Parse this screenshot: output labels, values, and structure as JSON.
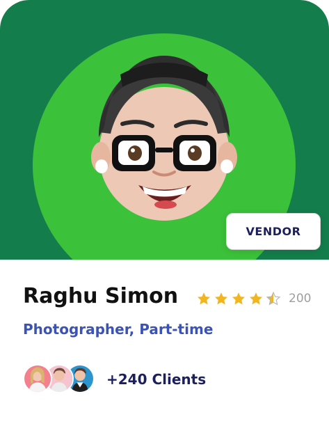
{
  "profile": {
    "badge": "VENDOR",
    "name": "Raghu Simon",
    "role": "Photographer, Part-time",
    "rating_value": 4.5,
    "rating_max": 5,
    "rating_count": "200",
    "clients_label": "+240 Clients"
  },
  "colors": {
    "hero_bg": "#147d4c",
    "avatar_circle": "#3cc13a",
    "star": "#f0b51f",
    "role_text": "#3a53b5",
    "clients_text": "#1c1f5e"
  },
  "icons": {
    "avatar": "memoji-avatar",
    "star": "star-icon",
    "client_1": "client-avatar-icon",
    "client_2": "client-avatar-icon",
    "client_3": "client-avatar-icon"
  }
}
